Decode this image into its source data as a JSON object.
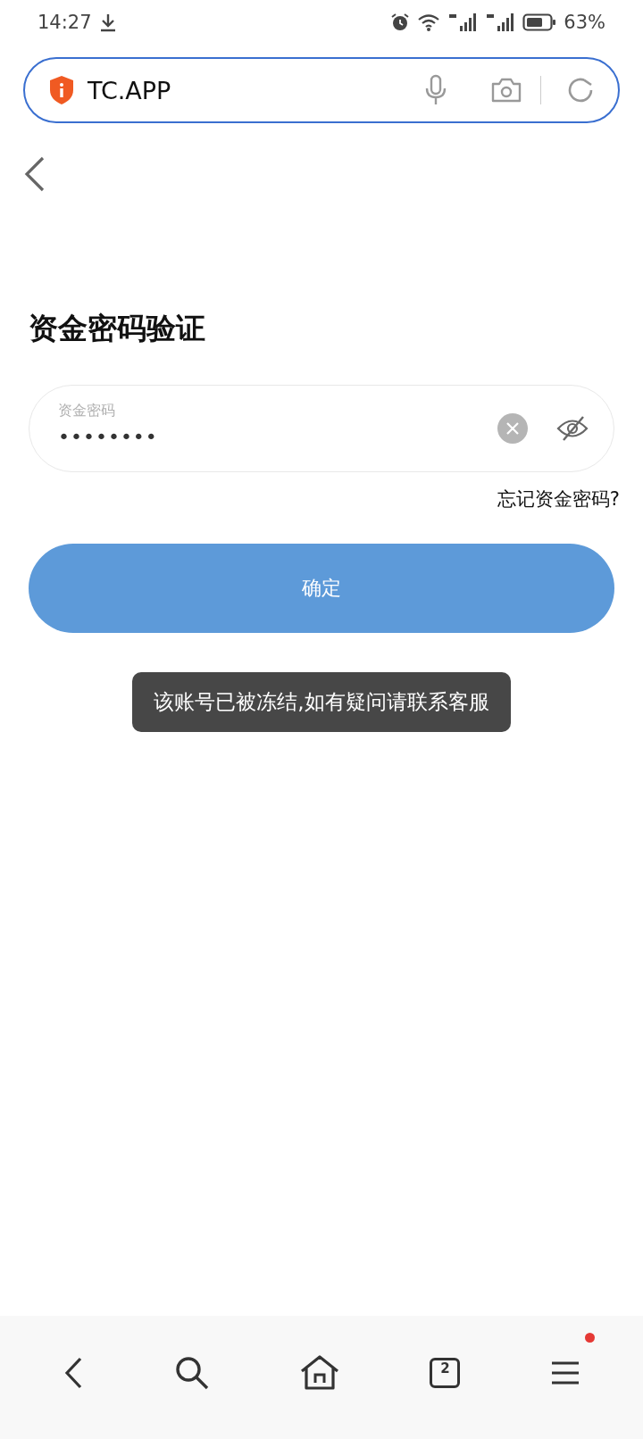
{
  "status_bar": {
    "time": "14:27",
    "battery": "63%"
  },
  "address_bar": {
    "url": "TC.APP"
  },
  "page": {
    "title": "资金密码验证",
    "password_field": {
      "label": "资金密码",
      "value": "••••••••"
    },
    "forgot_link": "忘记资金密码?",
    "confirm_button": "确定"
  },
  "toast": "该账号已被冻结,如有疑问请联系客服",
  "bottom_nav": {
    "tab_count": "2",
    "menu_notification": true
  }
}
